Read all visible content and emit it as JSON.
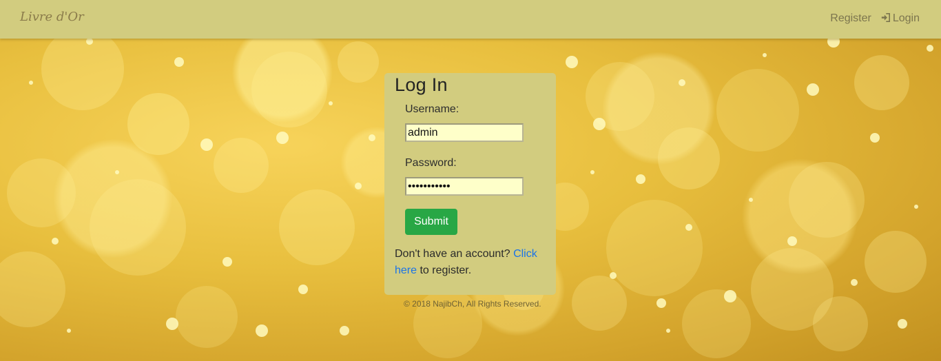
{
  "navbar": {
    "brand": "Livre d'Or",
    "register_label": "Register",
    "login_label": "Login",
    "login_icon": "sign-in-icon"
  },
  "login_form": {
    "title": "Log In",
    "username_label": "Username:",
    "username_value": "admin",
    "password_label": "Password:",
    "password_value": "•••••••••••",
    "submit_label": "Submit",
    "register_prompt_before": "Don't have an account? ",
    "register_link_text": "Click here",
    "register_prompt_after": " to register."
  },
  "footer": {
    "text": "© 2018 NajibCh, All Rights Reserved."
  },
  "colors": {
    "navbar_bg": "#d2cc7f",
    "card_bg": "#d2cc7f",
    "input_bg": "#feffc9",
    "submit_bg": "#28a745",
    "link": "#1a73e8"
  }
}
